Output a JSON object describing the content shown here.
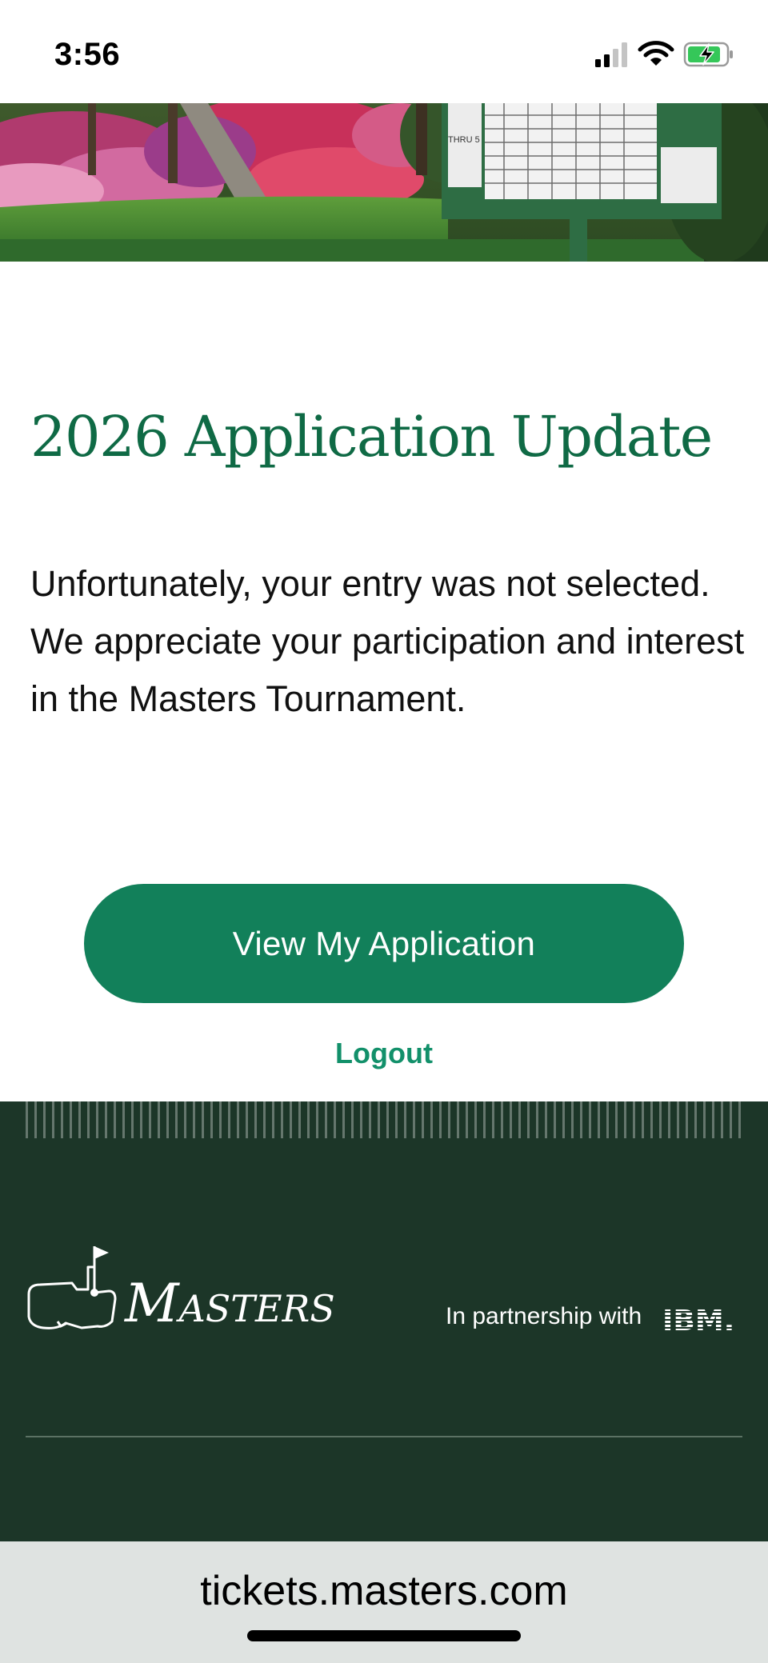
{
  "status_bar": {
    "time": "3:56",
    "icons": [
      "cellular-signal-icon",
      "wifi-icon",
      "battery-charging-icon"
    ]
  },
  "hero": {
    "scoreboard_text": "THRU 5"
  },
  "content": {
    "title": "2026 Application Update",
    "message": "Unfortunately, your entry was not selected. We appreciate your participation and interest in the Masters Tournament.",
    "view_button_label": "View My Application",
    "logout_label": "Logout"
  },
  "footer": {
    "logo_text": "Masters",
    "partnership_text": "In partnership with",
    "partner_logo_text": "IBM."
  },
  "browser": {
    "url": "tickets.masters.com"
  },
  "colors": {
    "brand_green": "#12805a",
    "title_green": "#0f6a45",
    "footer_green": "#1c3628",
    "link_green": "#12906a"
  }
}
